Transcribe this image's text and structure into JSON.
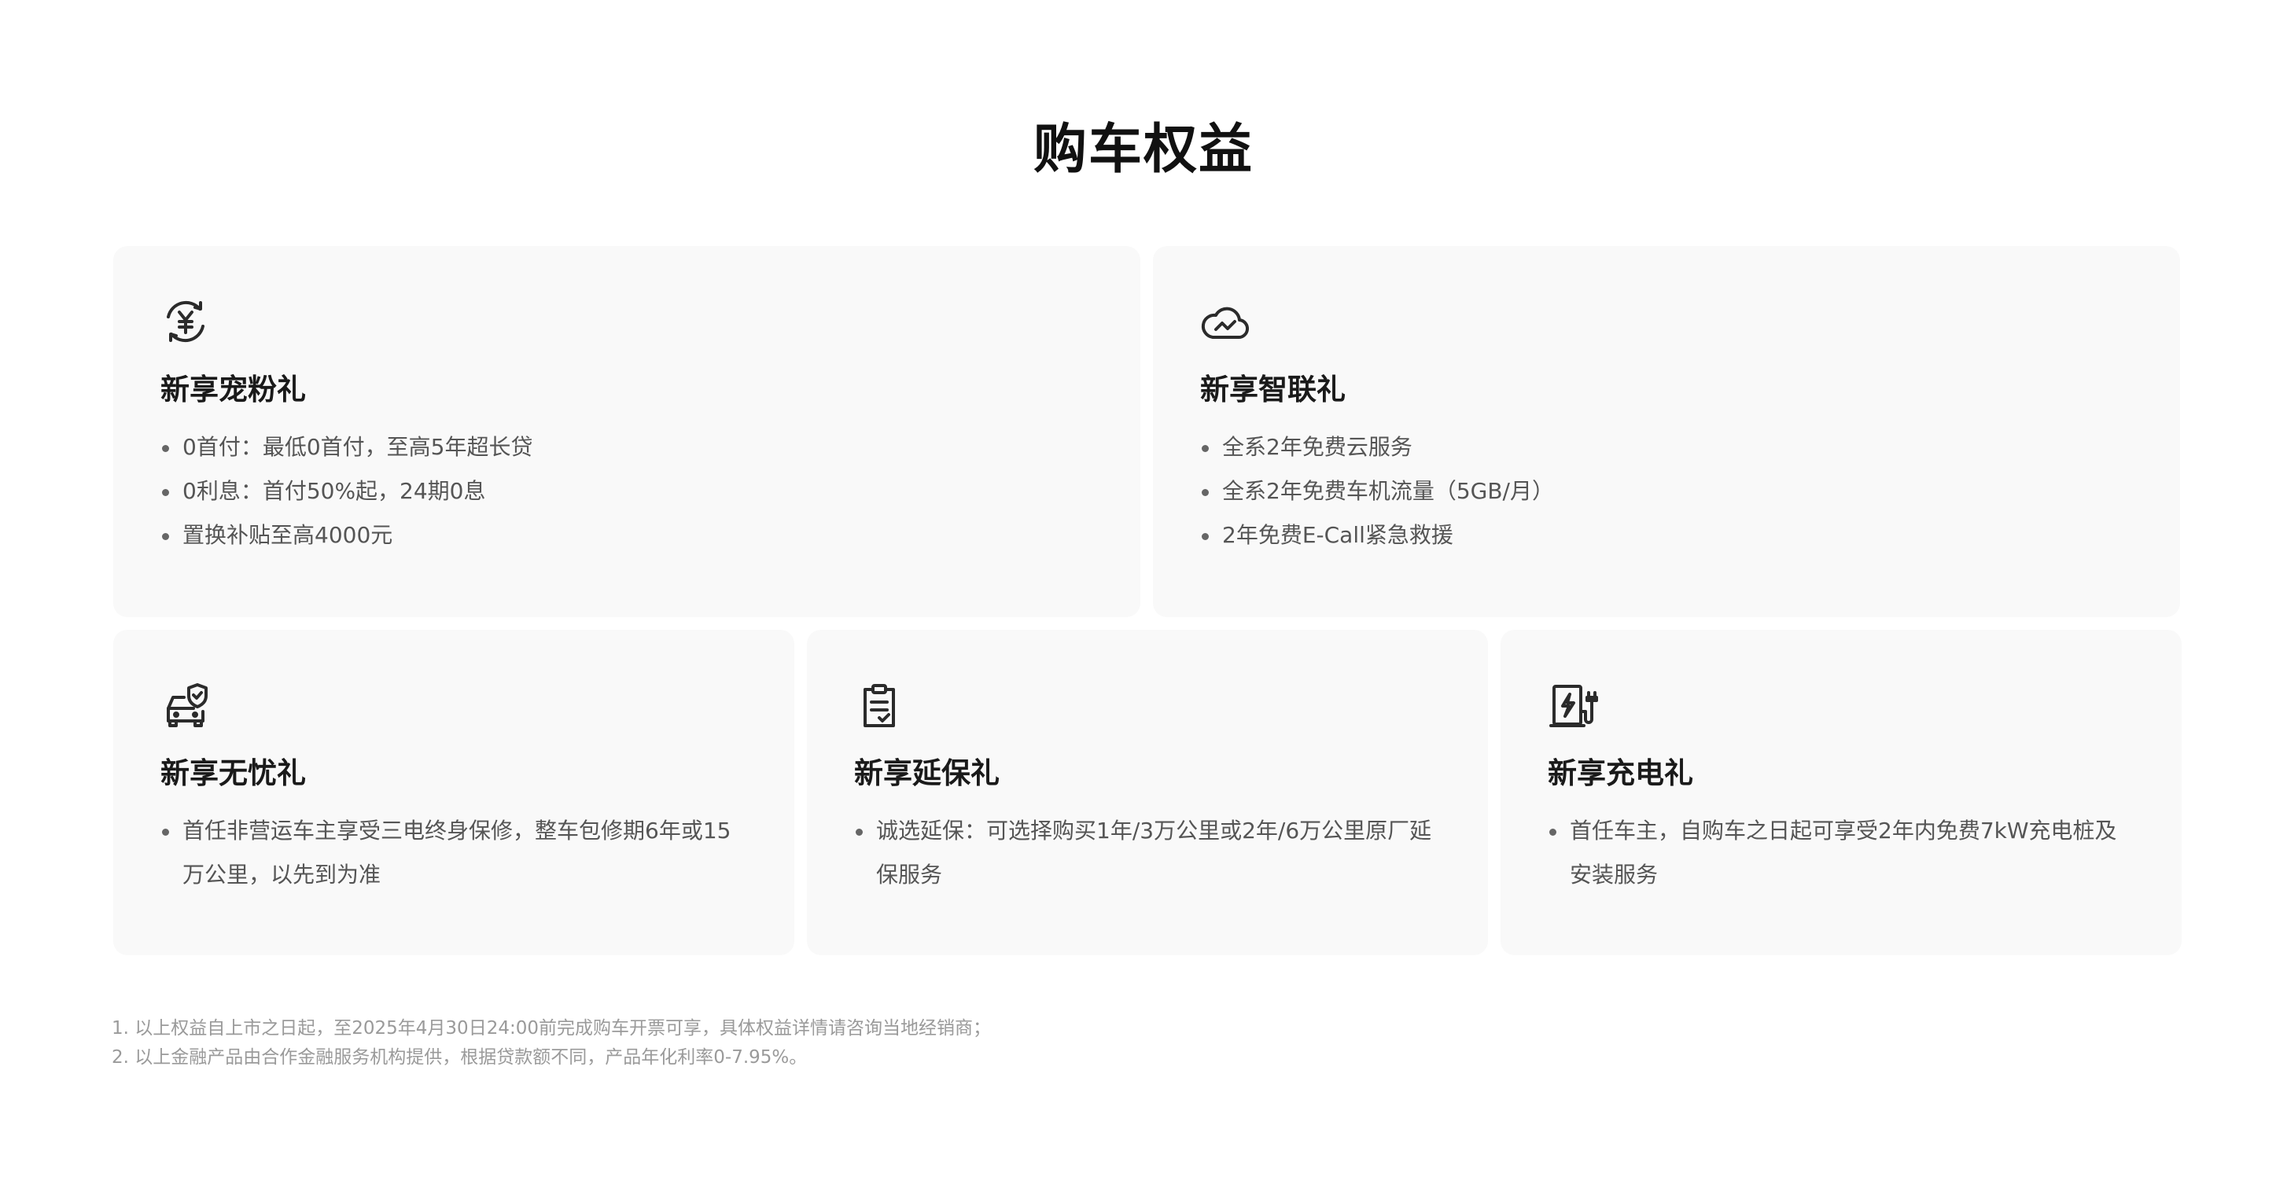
{
  "page": {
    "title": "购车权益"
  },
  "cards": [
    {
      "icon": "yen-exchange-icon",
      "title": "新享宠粉礼",
      "items": [
        "0首付：最低0首付，至高5年超长贷",
        "0利息：首付50%起，24期0息",
        "置换补贴至高4000元"
      ]
    },
    {
      "icon": "cloud-connect-icon",
      "title": "新享智联礼",
      "items": [
        "全系2年免费云服务",
        "全系2年免费车机流量（5GB/月）",
        "2年免费E-Call紧急救援"
      ]
    },
    {
      "icon": "car-shield-icon",
      "title": "新享无忧礼",
      "items": [
        "首任非营运车主享受三电终身保修，整车包修期6年或15万公里，以先到为准"
      ]
    },
    {
      "icon": "clipboard-check-icon",
      "title": "新享延保礼",
      "items": [
        "诚选延保：可选择购买1年/3万公里或2年/6万公里原厂延保服务"
      ]
    },
    {
      "icon": "charging-pile-icon",
      "title": "新享充电礼",
      "items": [
        "首任车主，自购车之日起可享受2年内免费7kW充电桩及安装服务"
      ]
    }
  ],
  "footnotes": [
    "1. 以上权益自上市之日起，至2025年4月30日24:00前完成购车开票可享，具体权益详情请咨询当地经销商；",
    "2. 以上金融产品由合作金融服务机构提供，根据贷款额不同，产品年化利率0-7.95%。"
  ]
}
